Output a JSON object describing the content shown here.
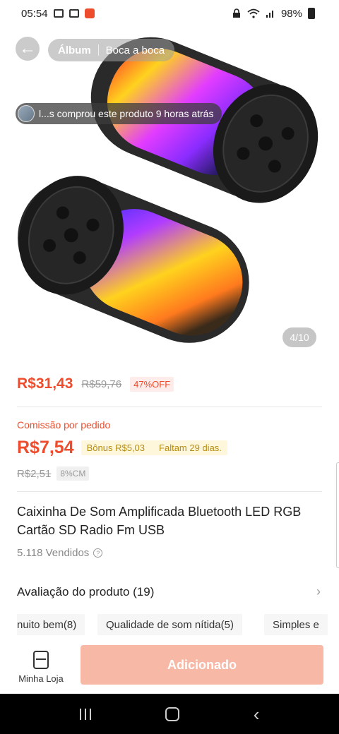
{
  "status_bar": {
    "time": "05:54",
    "battery": "98%"
  },
  "top_nav": {
    "back_icon": "arrow-left-icon",
    "tab_album": "Álbum",
    "tab_reviews": "Boca a boca"
  },
  "toast": {
    "text": "l...s comprou este produto 9 horas atrás"
  },
  "gallery": {
    "counter": "4/10"
  },
  "price": {
    "current": "R$31,43",
    "original": "R$59,76",
    "discount": "47%OFF"
  },
  "commission": {
    "label": "Comissão por pedido",
    "value": "R$7,54",
    "bonus": "Bônus R$5,03",
    "days_left": "Faltam 29 dias.",
    "old_value": "R$2,51",
    "rate": "8%CM"
  },
  "product": {
    "title": "Caixinha De Som Amplificada Bluetooth LED RGB Cartão SD Radio Fm USB",
    "sold": "5.118 Vendidos"
  },
  "reviews": {
    "title": "Avaliação do produto (19)",
    "tags": [
      "nuito bem(8)",
      "Qualidade de som nítida(5)",
      "Simples e"
    ]
  },
  "bottom": {
    "store_label": "Minha Loja",
    "add_button": "Adicionado"
  },
  "colors": {
    "accent": "#ee4d2d",
    "bonus_text": "#b68c12",
    "add_button_disabled": "#f7b8a6"
  }
}
